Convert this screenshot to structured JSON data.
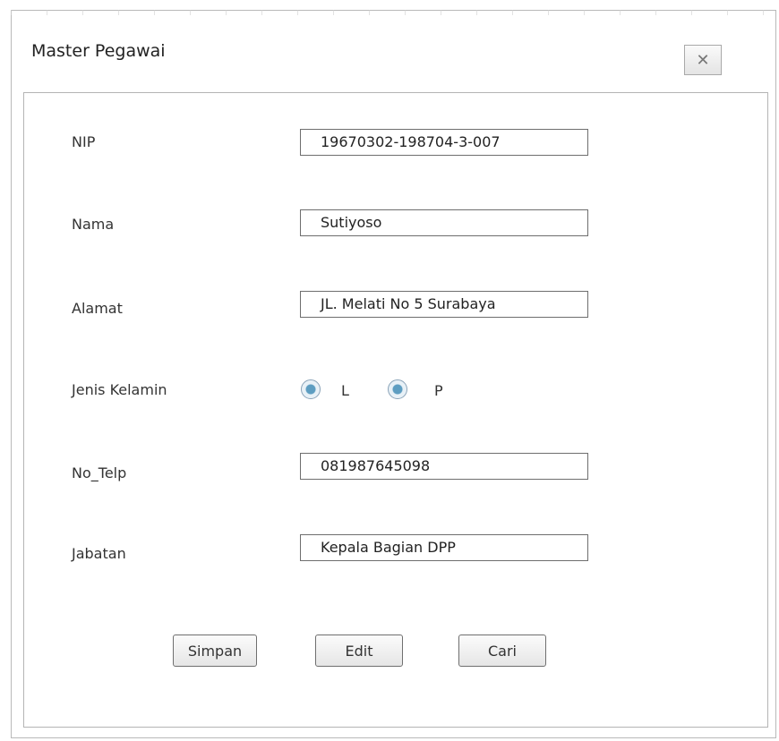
{
  "window": {
    "title": "Master Pegawai",
    "close_glyph": "✕"
  },
  "form": {
    "nip": {
      "label": "NIP",
      "value": "19670302-198704-3-007"
    },
    "nama": {
      "label": "Nama",
      "value": "Sutiyoso"
    },
    "alamat": {
      "label": "Alamat",
      "value": "JL. Melati No 5 Surabaya"
    },
    "jenis_kelamin": {
      "label": "Jenis Kelamin",
      "options": [
        "L",
        "P"
      ]
    },
    "no_telp": {
      "label": "No_Telp",
      "value": "081987645098"
    },
    "jabatan": {
      "label": "Jabatan",
      "value": "Kepala Bagian DPP"
    }
  },
  "buttons": {
    "save": "Simpan",
    "edit": "Edit",
    "search": "Cari"
  },
  "icons": {
    "close": "close-icon"
  }
}
